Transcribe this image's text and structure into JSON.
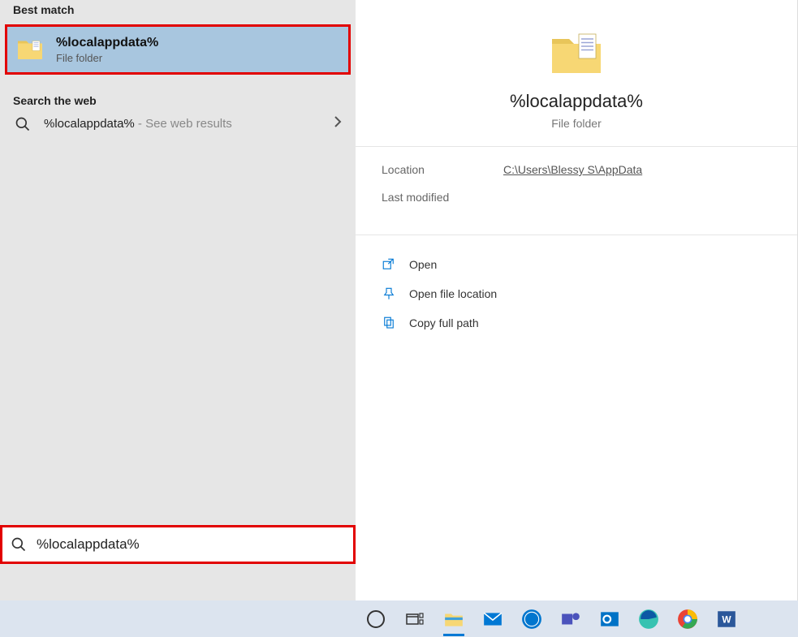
{
  "left": {
    "best_match_header": "Best match",
    "best_match": {
      "title": "%localappdata%",
      "subtitle": "File folder"
    },
    "web_header": "Search the web",
    "web_result": {
      "query": "%localappdata%",
      "suffix": " - See web results"
    }
  },
  "preview": {
    "title": "%localappdata%",
    "subtitle": "File folder"
  },
  "details": {
    "location_label": "Location",
    "location_value": "C:\\Users\\Blessy S\\AppData",
    "last_modified_label": "Last modified"
  },
  "actions": {
    "open": "Open",
    "open_location": "Open file location",
    "copy_path": "Copy full path"
  },
  "search": {
    "value": "%localappdata%"
  },
  "icons": {
    "folder": "folder-icon",
    "search": "search-icon",
    "chevron": "chevron-right-icon",
    "open": "open-external-icon",
    "pin": "pin-icon",
    "copy": "copy-icon"
  },
  "taskbar": {
    "cortana": "Cortana",
    "taskview": "Task View",
    "explorer": "File Explorer",
    "mail": "Mail",
    "dell": "Dell",
    "teams": "Teams",
    "outlook": "Outlook",
    "edge": "Edge",
    "chrome": "Chrome",
    "word": "Word"
  }
}
